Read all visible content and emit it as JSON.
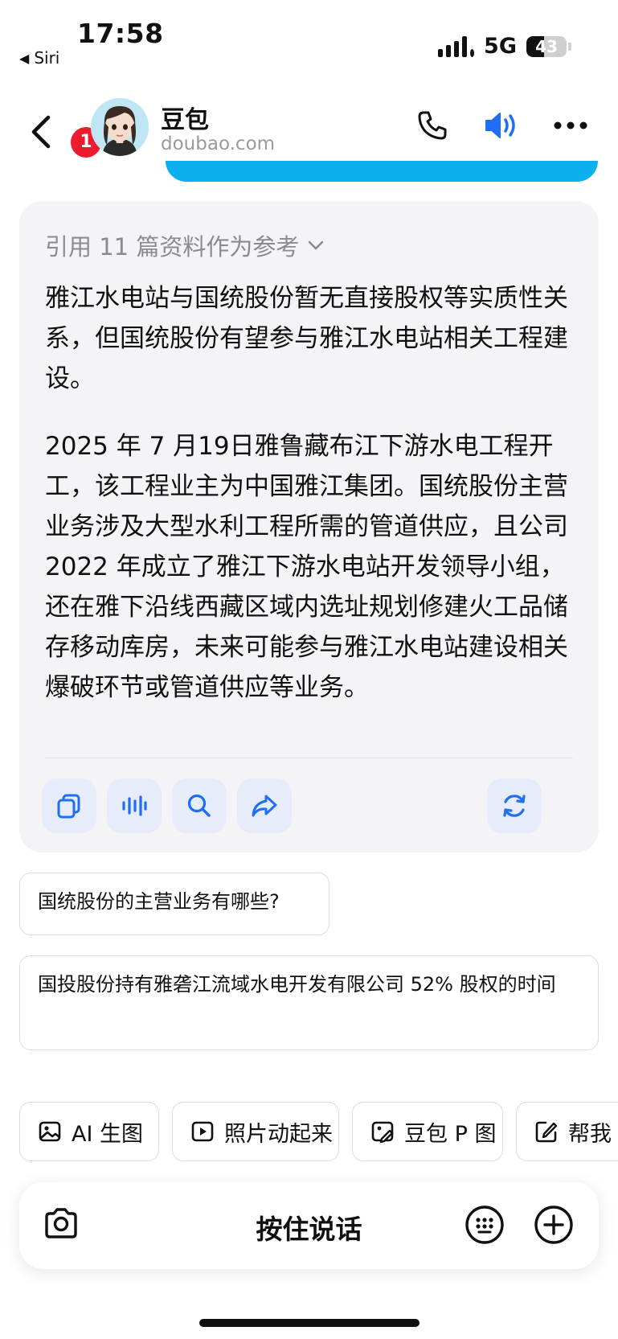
{
  "status_bar": {
    "time": "17:58",
    "back_app": "Siri",
    "network": "5G",
    "battery": "43",
    "battery_level": 0.43
  },
  "header": {
    "unread_count": "1",
    "bot_name": "豆包",
    "bot_domain": "doubao.com",
    "icons": [
      "back-chevron-icon",
      "phone-icon",
      "speaker-icon",
      "more-icon"
    ],
    "accent_color": "#0bb0ef"
  },
  "answer": {
    "reference_label": "引用 11 篇资料作为参考",
    "paragraph_1": "雅江水电站与国统股份暂无直接股权等实质性关系，但国统股份有望参与雅江水电站相关工程建设。",
    "paragraph_2": "2025 年 7 月19日雅鲁藏布江下游水电工程开工，该工程业主为中国雅江集团。国统股份主营业务涉及大型水利工程所需的管道供应，且公司 2022 年成立了雅江下游水电站开发领导小组，还在雅下沿线西藏区域内选址规划修建火工品储存移动库房，未来可能参与雅江水电站建设相关爆破环节或管道供应等业务。",
    "actions": [
      "copy-icon",
      "voice-wave-icon",
      "search-icon",
      "share-icon",
      "regenerate-icon"
    ]
  },
  "suggestions": [
    "国统股份的主营业务有哪些?",
    "国投股份持有雅砻江流域水电开发有限公司 52% 股权的时间"
  ],
  "tools": [
    {
      "label": "AI 生图",
      "icon": "image-icon"
    },
    {
      "label": "照片动起来",
      "icon": "play-icon"
    },
    {
      "label": "豆包 P 图",
      "icon": "photo-edit-icon"
    },
    {
      "label": "帮我",
      "icon": "write-icon"
    }
  ],
  "input_bar": {
    "hold_to_talk": "按住说话",
    "icons": [
      "camera-icon",
      "keyboard-icon",
      "plus-icon"
    ]
  }
}
